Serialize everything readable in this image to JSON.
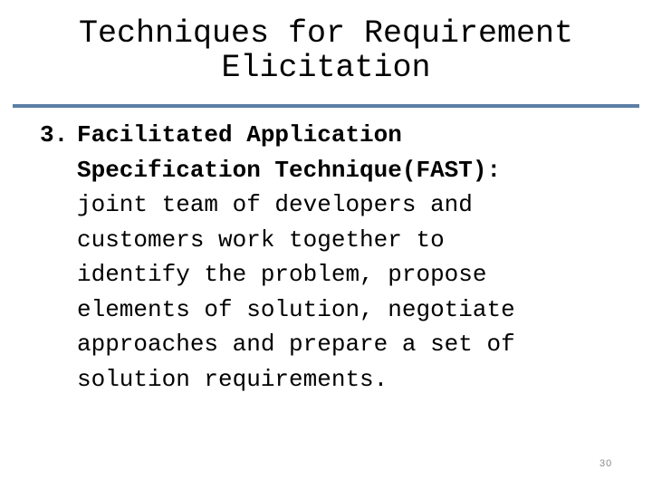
{
  "slide": {
    "title_lines": [
      "Techniques for Requirement",
      "Elicitation"
    ],
    "item_number": "3.",
    "heading_lines": [
      "Facilitated Application",
      "Specification Technique(FAST):"
    ],
    "body_lines": [
      "joint team of developers and",
      "customers work together to",
      "identify the problem, propose",
      "elements of solution, negotiate",
      "approaches and prepare a set of",
      "solution requirements."
    ],
    "page_number": "30",
    "accent_color": "#5b7fa6"
  }
}
